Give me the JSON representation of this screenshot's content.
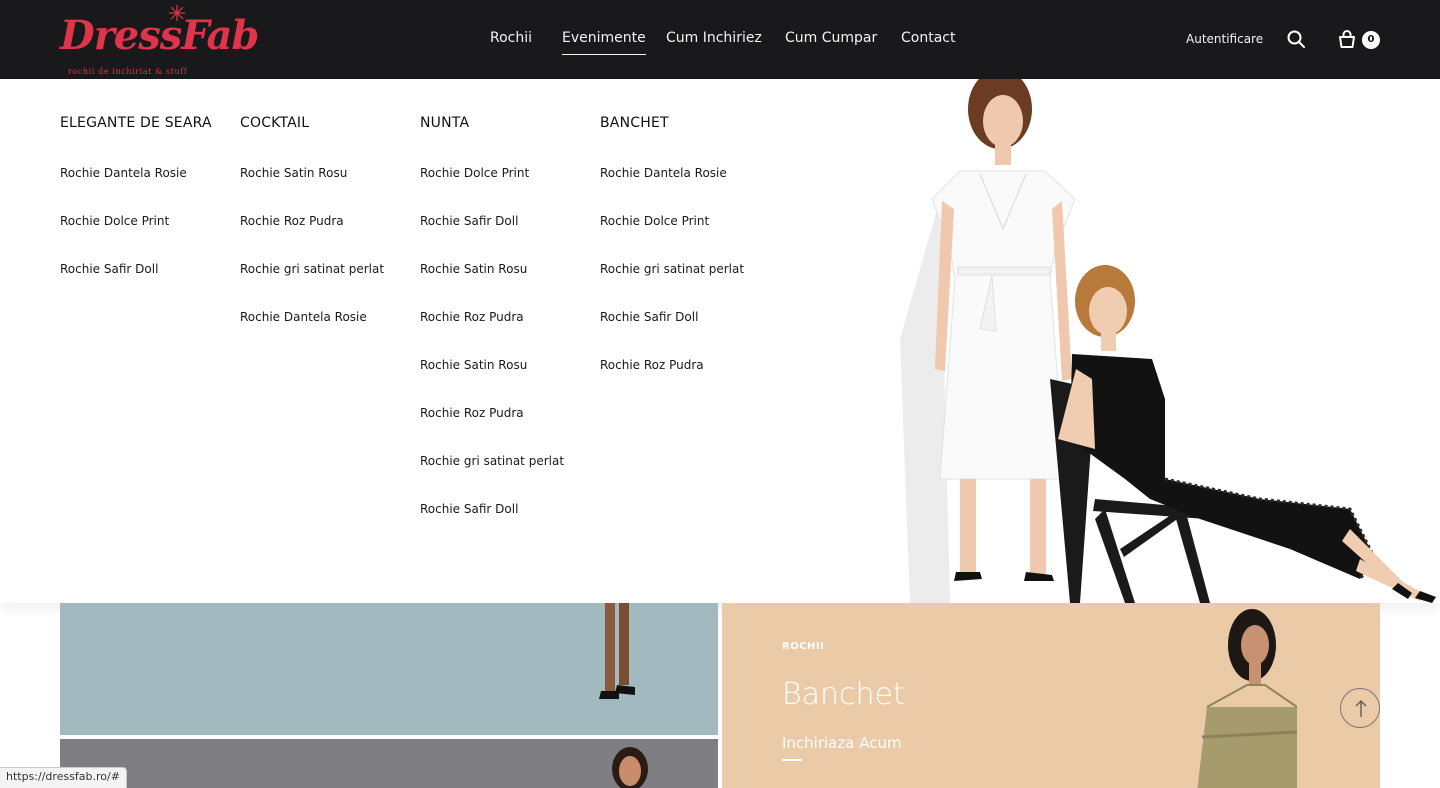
{
  "brand": {
    "name": "DressFab",
    "tagline": "rochii de inchiriat & stuff",
    "color": "#e0344a"
  },
  "nav": {
    "items": [
      {
        "label": "Rochii",
        "active": false
      },
      {
        "label": "Evenimente",
        "active": true
      },
      {
        "label": "Cum Inchiriez",
        "active": false
      },
      {
        "label": "Cum Cumpar",
        "active": false
      },
      {
        "label": "Contact",
        "active": false
      }
    ],
    "login_label": "Autentificare",
    "search_icon": "search-icon",
    "cart_icon": "shopping-bag-icon",
    "cart_count": "0"
  },
  "mega_menu": {
    "columns": [
      {
        "title": "ELEGANTE DE SEARA",
        "links": [
          "Rochie Dantela Rosie",
          "Rochie Dolce Print",
          "Rochie Safir Doll"
        ]
      },
      {
        "title": "COCKTAIL",
        "links": [
          "Rochie Satin Rosu",
          "Rochie Roz Pudra",
          "Rochie gri satinat perlat",
          "Rochie Dantela Rosie"
        ]
      },
      {
        "title": "NUNTA",
        "links": [
          "Rochie Dolce Print",
          "Rochie Safir Doll",
          "Rochie Satin Rosu",
          "Rochie Roz Pudra",
          "Rochie Satin Rosu",
          "Rochie Roz Pudra",
          "Rochie gri satinat perlat",
          "Rochie Safir Doll"
        ]
      },
      {
        "title": "BANCHET",
        "links": [
          "Rochie Dantela Rosie",
          "Rochie Dolce Print",
          "Rochie gri satinat perlat",
          "Rochie Safir Doll",
          "Rochie Roz Pudra"
        ]
      }
    ]
  },
  "promo": {
    "tag": "ROCHII",
    "title": "Banchet",
    "cta": "Inchiriaza Acum",
    "background": "#ebcba7"
  },
  "scroll_top_icon": "arrow-up-icon",
  "status_url": "https://dressfab.ro/#"
}
